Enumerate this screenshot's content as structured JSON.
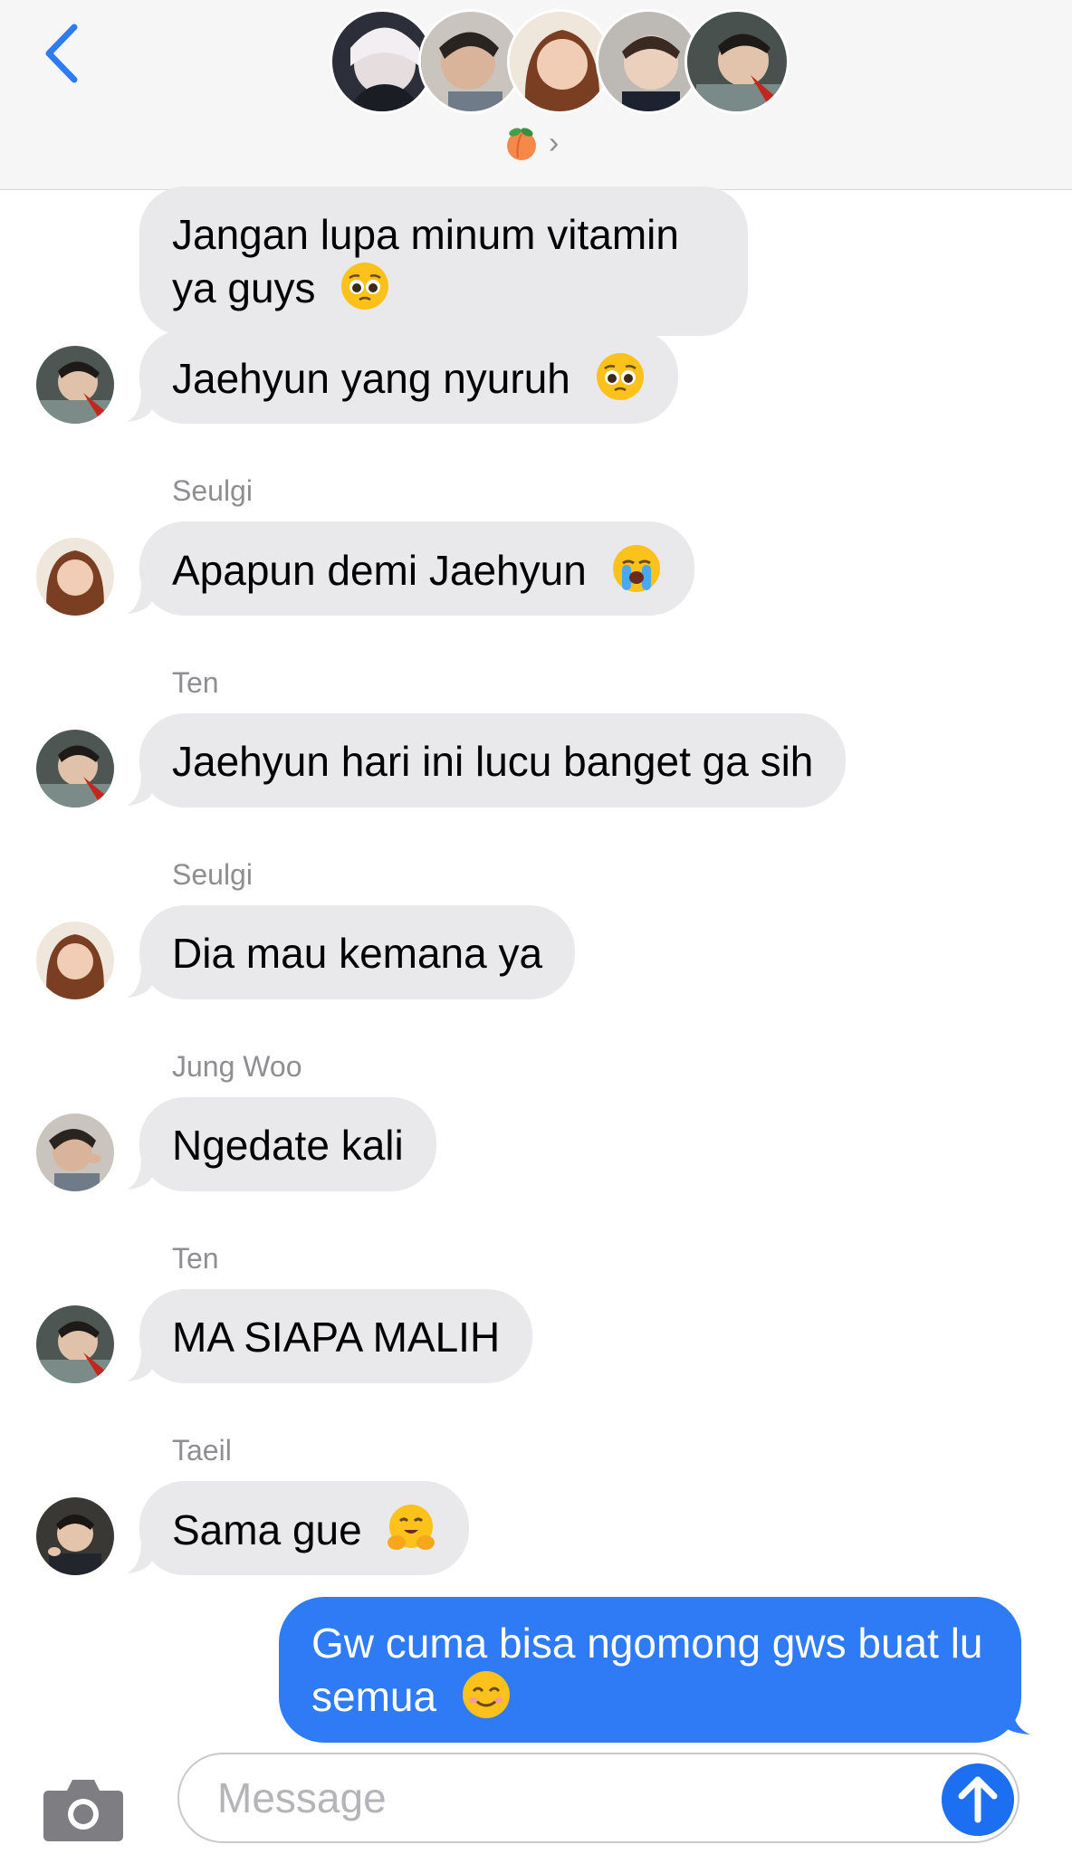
{
  "header": {
    "back_icon": "chevron-left-icon",
    "group_avatars": [
      "member-avatar-1",
      "member-avatar-2",
      "member-avatar-3",
      "member-avatar-4",
      "member-avatar-5"
    ],
    "group_icon": "peach-emoji",
    "chevron": "›"
  },
  "messages": [
    {
      "sender": "",
      "text": "Jangan lupa minum vitamin ya guys",
      "emoji": "pleading-face"
    },
    {
      "sender": "",
      "text": "Jaehyun yang nyuruh",
      "emoji": "pleading-face"
    },
    {
      "sender": "Seulgi",
      "text": "Apapun demi Jaehyun",
      "emoji": "loudly-crying-face"
    },
    {
      "sender": "Ten",
      "text": "Jaehyun hari ini lucu banget ga sih",
      "emoji": ""
    },
    {
      "sender": "Seulgi",
      "text": "Dia mau kemana ya",
      "emoji": ""
    },
    {
      "sender": "Jung Woo",
      "text": "Ngedate kali",
      "emoji": ""
    },
    {
      "sender": "Ten",
      "text": "MA SIAPA MALIH",
      "emoji": ""
    },
    {
      "sender": "Taeil",
      "text": "Sama gue",
      "emoji": "hugging-face"
    }
  ],
  "outgoing": {
    "text": "Gw cuma bisa ngomong gws buat lu semua",
    "emoji": "smiling-face"
  },
  "composer": {
    "placeholder": "Message",
    "camera_icon": "camera-icon",
    "send_icon": "send-arrow-icon"
  },
  "colors": {
    "incoming_bubble": "#e9e9eb",
    "outgoing_bubble": "#2f7bf5",
    "accent": "#1d6ff2",
    "meta_text": "#8e8e93"
  }
}
